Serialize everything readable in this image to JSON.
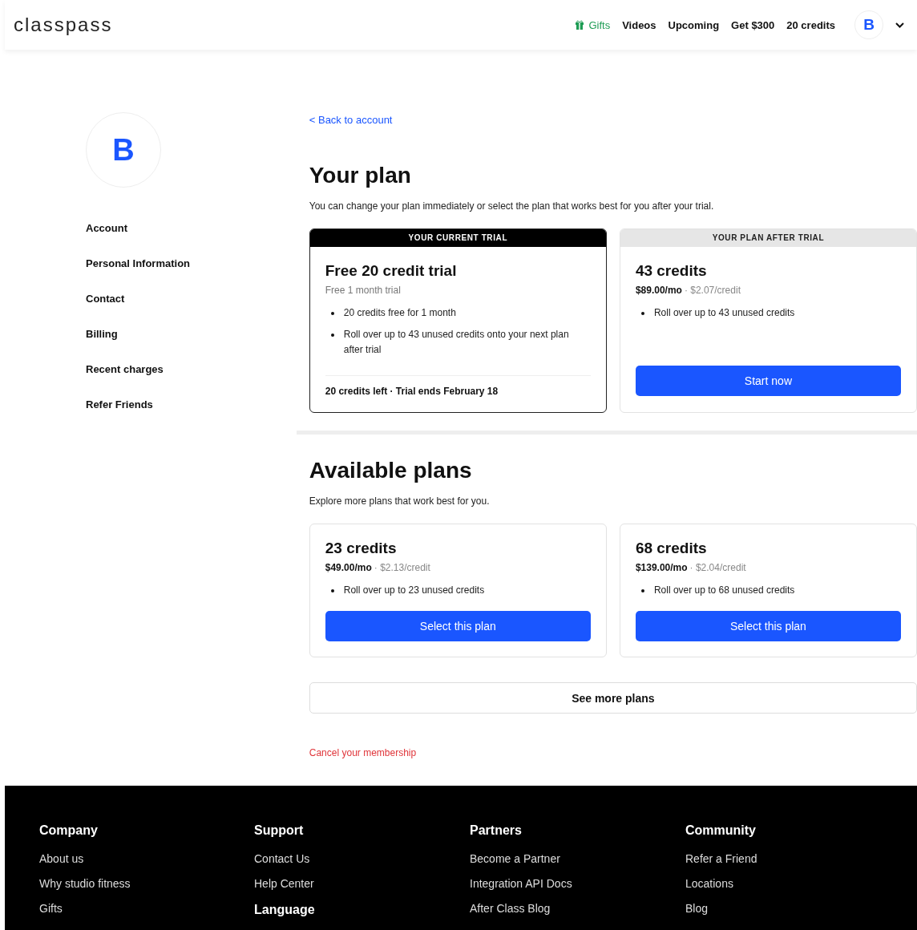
{
  "header": {
    "logo": "classpass",
    "nav": [
      {
        "label": "Gifts",
        "kind": "gift"
      },
      {
        "label": "Videos",
        "kind": "link"
      },
      {
        "label": "Upcoming",
        "kind": "link"
      },
      {
        "label": "Get $300",
        "kind": "link"
      },
      {
        "label": "20 credits",
        "kind": "link"
      }
    ],
    "avatar": "B"
  },
  "sidebar": {
    "avatar": "B",
    "items": [
      "Account",
      "Personal Information",
      "Contact",
      "Billing",
      "Recent charges",
      "Refer Friends"
    ]
  },
  "back_link": "< Back to account",
  "plan": {
    "title": "Your plan",
    "subtitle": "You can change your plan immediately or select the plan that works best for you after your trial.",
    "cards": [
      {
        "banner": "YOUR CURRENT TRIAL",
        "current": true,
        "title": "Free 20 credit trial",
        "subtitle": "Free 1 month trial",
        "bullets": [
          "20 credits free for 1 month",
          "Roll over up to 43 unused credits onto your next plan after trial"
        ],
        "footer": "20 credits left · Trial ends February 18"
      },
      {
        "banner": "YOUR PLAN AFTER TRIAL",
        "current": false,
        "title": "43 credits",
        "price": "$89.00/mo",
        "per_credit": "· $2.07/credit",
        "bullets": [
          "Roll over up to 43 unused credits"
        ],
        "button": "Start now"
      }
    ]
  },
  "available": {
    "title": "Available plans",
    "subtitle": "Explore more plans that work best for you.",
    "plans": [
      {
        "title": "23 credits",
        "price": "$49.00/mo",
        "per_credit": "· $2.13/credit",
        "bullets": [
          "Roll over up to 23 unused credits"
        ],
        "button": "Select this plan"
      },
      {
        "title": "68 credits",
        "price": "$139.00/mo",
        "per_credit": "· $2.04/credit",
        "bullets": [
          "Roll over up to 68 unused credits"
        ],
        "button": "Select this plan"
      }
    ],
    "more_button": "See more plans",
    "cancel_link": "Cancel your membership"
  },
  "footer": {
    "columns": [
      {
        "heading": "Company",
        "links": [
          "About us",
          "Why studio fitness",
          "Gifts"
        ]
      },
      {
        "heading": "Support",
        "links": [
          "Contact Us",
          "Help Center"
        ],
        "subheading": "Language"
      },
      {
        "heading": "Partners",
        "links": [
          "Become a Partner",
          "Integration API Docs",
          "After Class Blog"
        ]
      },
      {
        "heading": "Community",
        "links": [
          "Refer a Friend",
          "Locations",
          "Blog"
        ]
      }
    ]
  }
}
